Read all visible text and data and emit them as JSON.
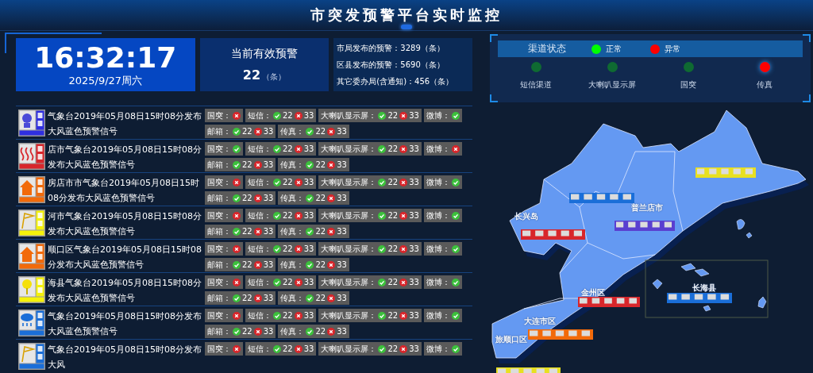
{
  "title": "市突发预警平台实时监控",
  "clock": {
    "time": "16:32:17",
    "date": "2025/9/27周六"
  },
  "active_alerts": {
    "label": "当前有效预警",
    "count": "22",
    "unit": "（条）"
  },
  "stats": [
    "市局发布的预警：3289（条）",
    "区县发布的预警：5690（条）",
    "其它委办局(含通知)：456（条）"
  ],
  "channel_status": {
    "title": "渠道状态",
    "legend": [
      {
        "label": "正常",
        "color": "#00ff00"
      },
      {
        "label": "异常",
        "color": "#ff0000"
      }
    ],
    "channels": [
      {
        "name": "短信渠道",
        "ok": true
      },
      {
        "name": "大喇叭显示屏",
        "ok": true
      },
      {
        "name": "国突",
        "ok": true
      },
      {
        "name": "传真",
        "ok": false
      }
    ]
  },
  "warnings": [
    {
      "kind": "pollution",
      "color": "#2f2fe0",
      "text": "气象台2019年05月08日15时08分发布大风蓝色预警信号",
      "channels": [
        {
          "kind": "status",
          "label": "国突：",
          "ok": false
        },
        {
          "kind": "count",
          "label": "短信：",
          "sent": "22",
          "failed": "33"
        },
        {
          "kind": "count",
          "label": "大喇叭显示屏：",
          "sent": "22",
          "failed": "33"
        },
        {
          "kind": "status",
          "label": "微博：",
          "ok": true
        },
        {
          "kind": "count",
          "label": "邮箱：",
          "sent": "22",
          "failed": "33"
        },
        {
          "kind": "count",
          "label": "传真：",
          "sent": "22",
          "failed": "33"
        }
      ]
    },
    {
      "kind": "drought",
      "color": "#d8262b",
      "text": "店市气象台2019年05月08日15时08分发布大风蓝色预警信号",
      "channels": [
        {
          "kind": "status",
          "label": "国突：",
          "ok": true
        },
        {
          "kind": "count",
          "label": "短信：",
          "sent": "22",
          "failed": "33"
        },
        {
          "kind": "count",
          "label": "大喇叭显示屏：",
          "sent": "22",
          "failed": "33"
        },
        {
          "kind": "status",
          "label": "微博：",
          "ok": false
        },
        {
          "kind": "count",
          "label": "邮箱：",
          "sent": "22",
          "failed": "33"
        },
        {
          "kind": "count",
          "label": "传真：",
          "sent": "22",
          "failed": "33"
        }
      ]
    },
    {
      "kind": "heat",
      "color": "#f26a0a",
      "text": "房店市市气象台2019年05月08日15时08分发布大风蓝色预警信号",
      "channels": [
        {
          "kind": "status",
          "label": "国突：",
          "ok": false
        },
        {
          "kind": "count",
          "label": "短信：",
          "sent": "22",
          "failed": "33"
        },
        {
          "kind": "count",
          "label": "大喇叭显示屏：",
          "sent": "22",
          "failed": "33"
        },
        {
          "kind": "status",
          "label": "微博：",
          "ok": true
        },
        {
          "kind": "count",
          "label": "邮箱：",
          "sent": "22",
          "failed": "33"
        },
        {
          "kind": "count",
          "label": "传真：",
          "sent": "22",
          "failed": "33"
        }
      ]
    },
    {
      "kind": "wind",
      "color": "#f5f20a",
      "text": "河市气象台2019年05月08日15时08分发布大风蓝色预警信号",
      "channels": [
        {
          "kind": "status",
          "label": "国突：",
          "ok": false
        },
        {
          "kind": "count",
          "label": "短信：",
          "sent": "22",
          "failed": "33"
        },
        {
          "kind": "count",
          "label": "大喇叭显示屏：",
          "sent": "22",
          "failed": "33"
        },
        {
          "kind": "status",
          "label": "微博：",
          "ok": true
        },
        {
          "kind": "count",
          "label": "邮箱：",
          "sent": "22",
          "failed": "33"
        },
        {
          "kind": "count",
          "label": "传真：",
          "sent": "22",
          "failed": "33"
        }
      ]
    },
    {
      "kind": "heat",
      "color": "#f26a0a",
      "text": "顺口区气象台2019年05月08日15时08分发布大风蓝色预警信号",
      "channels": [
        {
          "kind": "status",
          "label": "国突：",
          "ok": false
        },
        {
          "kind": "count",
          "label": "短信：",
          "sent": "22",
          "failed": "33"
        },
        {
          "kind": "count",
          "label": "大喇叭显示屏：",
          "sent": "22",
          "failed": "33"
        },
        {
          "kind": "status",
          "label": "微博：",
          "ok": true
        },
        {
          "kind": "count",
          "label": "邮箱：",
          "sent": "22",
          "failed": "33"
        },
        {
          "kind": "count",
          "label": "传真：",
          "sent": "22",
          "failed": "33"
        }
      ]
    },
    {
      "kind": "hail",
      "color": "#f5f20a",
      "text": "海县气象台2019年05月08日15时08分发布大风蓝色预警信号",
      "channels": [
        {
          "kind": "status",
          "label": "国突：",
          "ok": false
        },
        {
          "kind": "count",
          "label": "短信：",
          "sent": "22",
          "failed": "33"
        },
        {
          "kind": "count",
          "label": "大喇叭显示屏：",
          "sent": "22",
          "failed": "33"
        },
        {
          "kind": "status",
          "label": "微博：",
          "ok": true
        },
        {
          "kind": "count",
          "label": "邮箱：",
          "sent": "22",
          "failed": "33"
        },
        {
          "kind": "count",
          "label": "传真：",
          "sent": "22",
          "failed": "33"
        }
      ]
    },
    {
      "kind": "rainstorm",
      "color": "#1a6ed8",
      "text": "气象台2019年05月08日15时08分发布大风蓝色预警信号",
      "channels": [
        {
          "kind": "status",
          "label": "国突：",
          "ok": false
        },
        {
          "kind": "count",
          "label": "短信：",
          "sent": "22",
          "failed": "33"
        },
        {
          "kind": "count",
          "label": "大喇叭显示屏：",
          "sent": "22",
          "failed": "33"
        },
        {
          "kind": "status",
          "label": "微博：",
          "ok": true
        },
        {
          "kind": "count",
          "label": "邮箱：",
          "sent": "22",
          "failed": "33"
        },
        {
          "kind": "count",
          "label": "传真：",
          "sent": "22",
          "failed": "33"
        }
      ]
    },
    {
      "kind": "wind",
      "color": "#1a6ed8",
      "text": "气象台2019年05月08日15时08分发布大风",
      "channels": [
        {
          "kind": "status",
          "label": "国突：",
          "ok": false
        },
        {
          "kind": "count",
          "label": "短信：",
          "sent": "22",
          "failed": "33"
        },
        {
          "kind": "count",
          "label": "大喇叭显示屏：",
          "sent": "22",
          "failed": "33"
        },
        {
          "kind": "status",
          "label": "微博：",
          "ok": true
        }
      ]
    }
  ],
  "map": {
    "regions": [
      "长兴岛",
      "普兰店市",
      "金州区",
      "长海县",
      "大连市区",
      "旅顺口区"
    ],
    "markers": [
      {
        "color": "#e8e020"
      },
      {
        "color": "#1a6ed8"
      },
      {
        "color": "#5a3fd0"
      },
      {
        "color": "#d8262b"
      },
      {
        "color": "#d8262b"
      },
      {
        "color": "#1a6ed8"
      },
      {
        "color": "#f26a0a"
      },
      {
        "color": "#e8e020"
      }
    ]
  }
}
